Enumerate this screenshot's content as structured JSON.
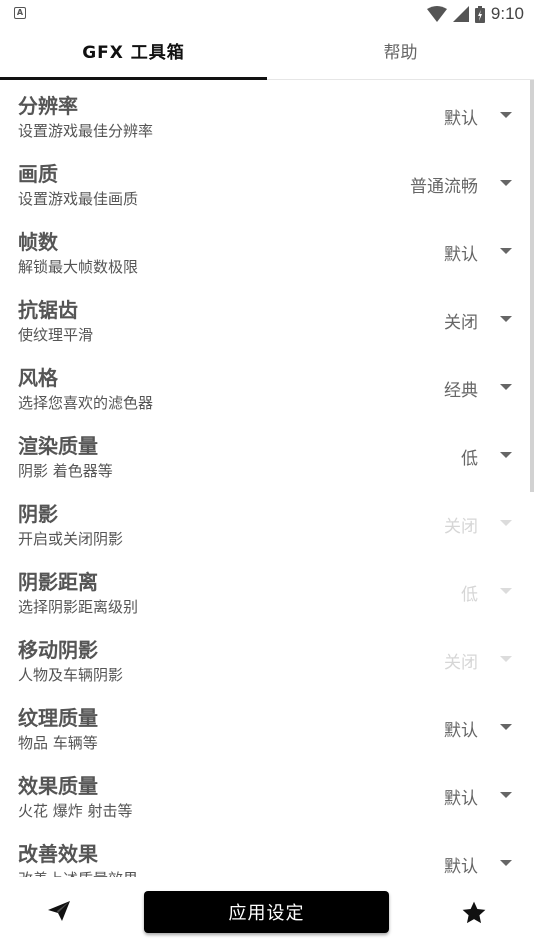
{
  "status_bar": {
    "time": "9:10",
    "notification": "A"
  },
  "tabs": [
    {
      "label": "GFX 工具箱",
      "active": true
    },
    {
      "label": "帮助",
      "active": false
    }
  ],
  "settings": [
    {
      "title": "分辨率",
      "subtitle": "设置游戏最佳分辨率",
      "value": "默认",
      "enabled": true
    },
    {
      "title": "画质",
      "subtitle": "设置游戏最佳画质",
      "value": "普通流畅",
      "enabled": true
    },
    {
      "title": "帧数",
      "subtitle": "解锁最大帧数极限",
      "value": "默认",
      "enabled": true
    },
    {
      "title": "抗锯齿",
      "subtitle": "使纹理平滑",
      "value": "关闭",
      "enabled": true
    },
    {
      "title": "风格",
      "subtitle": "选择您喜欢的滤色器",
      "value": "经典",
      "enabled": true
    },
    {
      "title": "渲染质量",
      "subtitle": "阴影 着色器等",
      "value": "低",
      "enabled": true
    },
    {
      "title": "阴影",
      "subtitle": "开启或关闭阴影",
      "value": "关闭",
      "enabled": false
    },
    {
      "title": "阴影距离",
      "subtitle": "选择阴影距离级别",
      "value": "低",
      "enabled": false
    },
    {
      "title": "移动阴影",
      "subtitle": "人物及车辆阴影",
      "value": "关闭",
      "enabled": false
    },
    {
      "title": "纹理质量",
      "subtitle": "物品 车辆等",
      "value": "默认",
      "enabled": true
    },
    {
      "title": "效果质量",
      "subtitle": "火花 爆炸 射击等",
      "value": "默认",
      "enabled": true
    },
    {
      "title": "改善效果",
      "subtitle": "改善上述质量效果",
      "value": "默认",
      "enabled": true
    }
  ],
  "bottom_bar": {
    "apply_label": "应用设定",
    "left_icon": "send-icon",
    "right_icon": "star-icon"
  }
}
